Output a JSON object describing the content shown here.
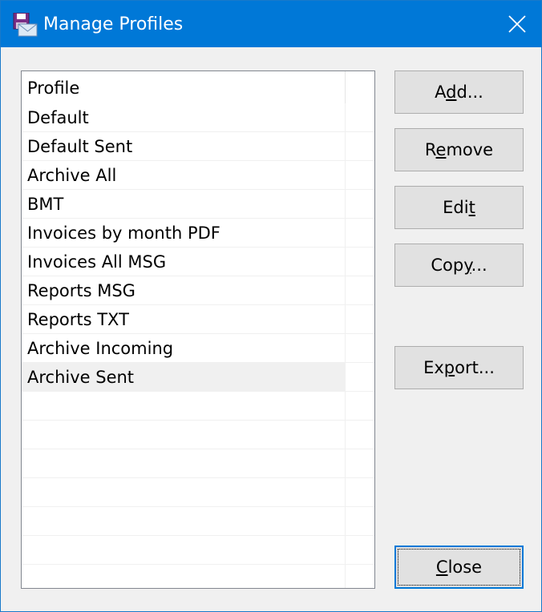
{
  "window": {
    "title": "Manage Profiles",
    "app_icon": "mail-disk-icon",
    "close_icon": "close-icon"
  },
  "list": {
    "header": "Profile",
    "items": [
      {
        "label": "Default",
        "selected": false
      },
      {
        "label": "Default Sent",
        "selected": false
      },
      {
        "label": "Archive All",
        "selected": false
      },
      {
        "label": "BMT",
        "selected": false
      },
      {
        "label": "Invoices by month PDF",
        "selected": false
      },
      {
        "label": "Invoices All MSG",
        "selected": false
      },
      {
        "label": "Reports MSG",
        "selected": false
      },
      {
        "label": "Reports TXT",
        "selected": false
      },
      {
        "label": "Archive Incoming",
        "selected": false
      },
      {
        "label": "Archive Sent",
        "selected": true
      },
      {
        "label": "",
        "selected": false
      },
      {
        "label": "",
        "selected": false
      },
      {
        "label": "",
        "selected": false
      },
      {
        "label": "",
        "selected": false
      },
      {
        "label": "",
        "selected": false
      },
      {
        "label": "",
        "selected": false
      },
      {
        "label": "",
        "selected": false
      }
    ]
  },
  "buttons": {
    "add": {
      "pre": "A",
      "mnemonic": "d",
      "post": "d..."
    },
    "remove": {
      "pre": "R",
      "mnemonic": "e",
      "post": "move"
    },
    "edit": {
      "pre": "Edi",
      "mnemonic": "t",
      "post": ""
    },
    "copy": {
      "pre": "Cop",
      "mnemonic": "y",
      "post": "..."
    },
    "export": {
      "pre": "Ex",
      "mnemonic": "p",
      "post": "ort..."
    },
    "close": {
      "pre": "",
      "mnemonic": "C",
      "post": "lose"
    }
  },
  "colors": {
    "titlebar": "#0078d7",
    "selection": "#f0f0f0",
    "dialog_bg": "#f0f0f0"
  }
}
